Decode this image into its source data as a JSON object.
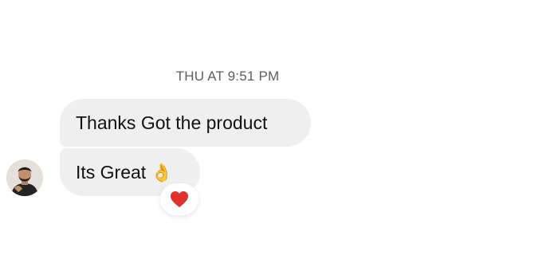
{
  "conversation": {
    "timestamp": "THU AT 9:51 PM",
    "messages": [
      {
        "text": "Thanks Got the product"
      },
      {
        "text": "Its Great",
        "emoji_name": "ok-hand-icon"
      }
    ],
    "reaction": {
      "emoji_name": "heart-icon",
      "color": "#e0302c"
    }
  },
  "colors": {
    "bubble_background": "#efefef",
    "timestamp_text": "#5e5e5e",
    "message_text": "#111111"
  }
}
